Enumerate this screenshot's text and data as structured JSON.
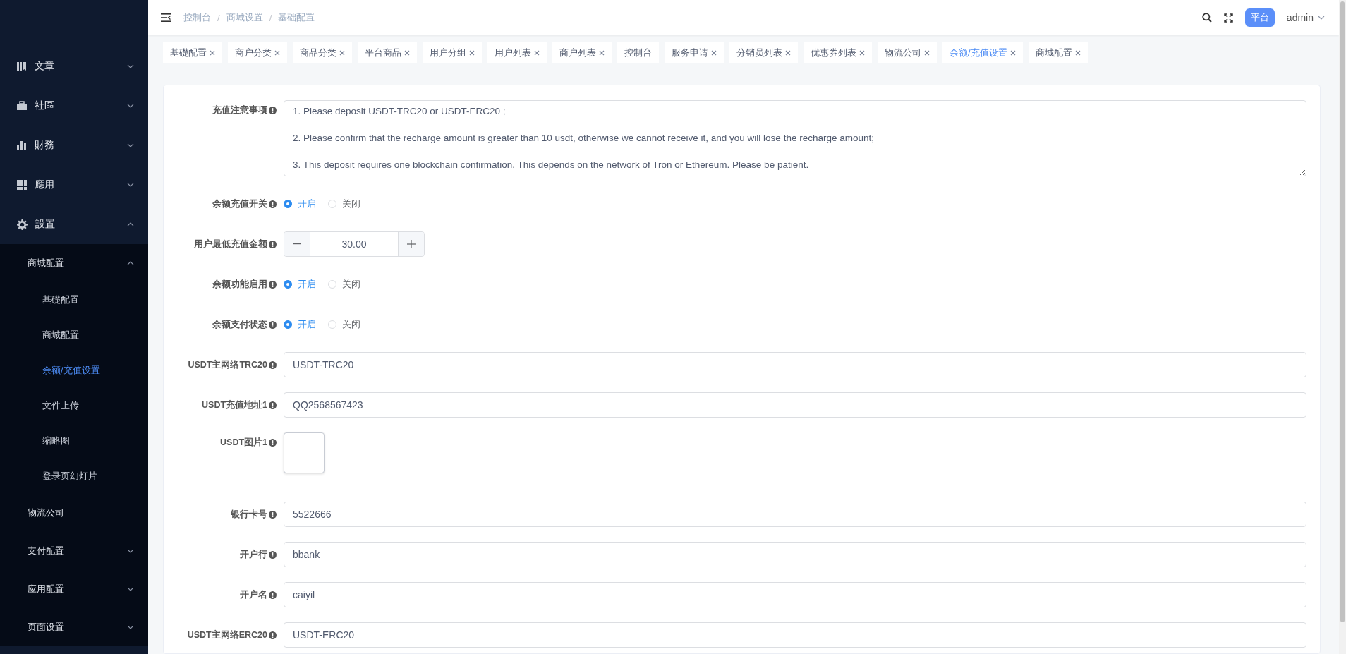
{
  "header": {
    "breadcrumb": [
      {
        "kind": "link",
        "text": "控制台"
      },
      {
        "kind": "separator",
        "text": "/"
      },
      {
        "kind": "link",
        "text": "商城设置"
      },
      {
        "kind": "separator",
        "text": "/"
      },
      {
        "kind": "link",
        "text": "基础配置"
      }
    ],
    "badge": "平台",
    "user": "admin"
  },
  "sidebar": {
    "items": [
      {
        "label": "文章",
        "expanded": false,
        "selected": false
      },
      {
        "label": "社區",
        "expanded": false,
        "selected": false
      },
      {
        "label": "財務",
        "expanded": false,
        "selected": false
      },
      {
        "label": "應用",
        "expanded": false,
        "selected": false
      },
      {
        "label": "設置",
        "expanded": true,
        "selected": false,
        "children": [
          {
            "label": "商城配置",
            "expanded": true,
            "selected": false,
            "children": [
              {
                "label": "基礎配置",
                "selected": false
              },
              {
                "label": "商城配置",
                "selected": false
              },
              {
                "label": "余额/充值设置",
                "selected": true
              },
              {
                "label": "文件上传",
                "selected": false
              },
              {
                "label": "缩略图",
                "selected": false
              },
              {
                "label": "登录页幻灯片",
                "selected": false
              }
            ]
          },
          {
            "label": "物流公司",
            "selected": false
          },
          {
            "label": "支付配置",
            "expanded": false,
            "selected": false
          },
          {
            "label": "应用配置",
            "expanded": false,
            "selected": false
          },
          {
            "label": "页面设置",
            "expanded": false,
            "selected": false
          }
        ]
      }
    ]
  },
  "tabs": [
    {
      "label": "基礎配置",
      "selected": false,
      "closable": true
    },
    {
      "label": "商户分类",
      "selected": false,
      "closable": true
    },
    {
      "label": "商品分类",
      "selected": false,
      "closable": true
    },
    {
      "label": "平台商品",
      "selected": false,
      "closable": true
    },
    {
      "label": "用户分组",
      "selected": false,
      "closable": true
    },
    {
      "label": "用户列表",
      "selected": false,
      "closable": true
    },
    {
      "label": "商户列表",
      "selected": false,
      "closable": true
    },
    {
      "label": "控制台",
      "selected": false,
      "closable": false
    },
    {
      "label": "服务申请",
      "selected": false,
      "closable": true
    },
    {
      "label": "分销员列表",
      "selected": false,
      "closable": true
    },
    {
      "label": "优惠券列表",
      "selected": false,
      "closable": true
    },
    {
      "label": "物流公司",
      "selected": false,
      "closable": true
    },
    {
      "label": "余额/充值设置",
      "selected": true,
      "closable": true
    },
    {
      "label": "商城配置",
      "selected": false,
      "closable": true
    }
  ],
  "form": {
    "fields": [
      {
        "kind": "textarea",
        "label": "充值注意事项",
        "value": "1. Please deposit USDT-TRC20 or USDT-ERC20 ;\n\n2. Please confirm that the recharge amount is greater than 10 usdt, otherwise we cannot receive it, and you will lose the recharge amount;\n\n3. This deposit requires one blockchain confirmation. This depends on the network of Tron or Ethereum. Please be patient."
      },
      {
        "kind": "radio",
        "label": "余额充值开关",
        "options": [
          {
            "label": "开启",
            "selected": true
          },
          {
            "label": "关闭",
            "selected": false
          }
        ]
      },
      {
        "kind": "number",
        "label": "用户最低充值金额",
        "value": "30.00"
      },
      {
        "kind": "radio",
        "label": "余额功能启用",
        "options": [
          {
            "label": "开启",
            "selected": true
          },
          {
            "label": "关闭",
            "selected": false
          }
        ]
      },
      {
        "kind": "radio",
        "label": "余额支付状态",
        "options": [
          {
            "label": "开启",
            "selected": true
          },
          {
            "label": "关闭",
            "selected": false
          }
        ]
      },
      {
        "kind": "text",
        "label": "USDT主网络TRC20",
        "value": "USDT-TRC20"
      },
      {
        "kind": "text",
        "label": "USDT充值地址1",
        "value": "QQ2568567423"
      },
      {
        "kind": "image",
        "label": "USDT图片1"
      },
      {
        "kind": "text",
        "label": "银行卡号",
        "value": "5522666"
      },
      {
        "kind": "text",
        "label": "开户行",
        "value": "bbank"
      },
      {
        "kind": "text",
        "label": "开户名",
        "value": "caiyil"
      },
      {
        "kind": "text",
        "label": "USDT主网络ERC20",
        "value": "USDT-ERC20"
      }
    ]
  }
}
